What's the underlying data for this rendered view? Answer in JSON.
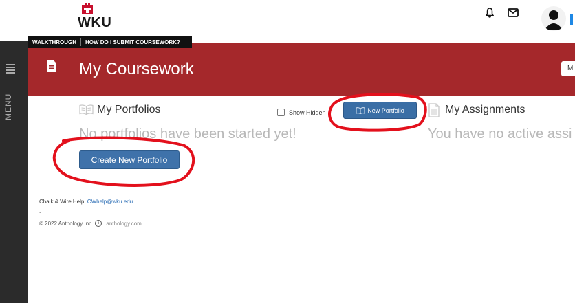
{
  "header": {
    "logo_text": "WKU",
    "icons": [
      "bell-icon",
      "mail-icon",
      "avatar-icon"
    ]
  },
  "walkthrough": {
    "walkthrough_label": "WALKTHROUGH",
    "help_label": "HOW DO I SUBMIT COURSEWORK?"
  },
  "menu": {
    "label": "MENU"
  },
  "page": {
    "title": "My Coursework",
    "top_right_button": "M"
  },
  "portfolios": {
    "title": "My Portfolios",
    "show_hidden_label": "Show Hidden",
    "show_hidden_checked": false,
    "new_button": "New Portfolio",
    "empty_text": "No portfolios have been started yet!",
    "create_button": "Create New Portfolio"
  },
  "assignments": {
    "title": "My Assignments",
    "empty_text": "You have no active assi"
  },
  "footer": {
    "help_prefix": "Chalk & Wire Help: ",
    "help_email": "CWhelp@wku.edu",
    "dot": ".",
    "copyright": "© 2022 Anthology Inc.",
    "anthology_link": "anthology.com"
  },
  "colors": {
    "brand_red": "#a5282b",
    "button_blue": "#3f72aa",
    "link_blue": "#2a6db5",
    "annotation_red": "#e3101c"
  }
}
